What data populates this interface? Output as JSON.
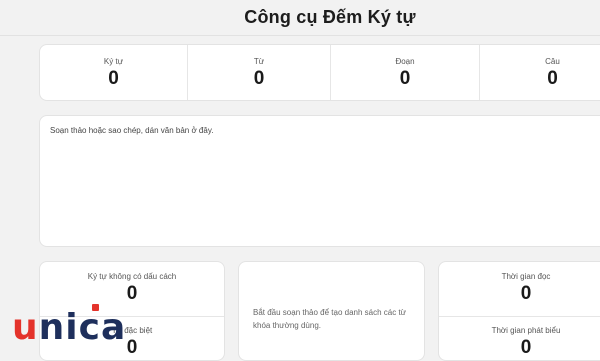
{
  "header": {
    "title": "Công cụ Đếm Ký tự"
  },
  "stats": [
    {
      "label": "Ký tự",
      "value": "0"
    },
    {
      "label": "Từ",
      "value": "0"
    },
    {
      "label": "Đoạn",
      "value": "0"
    },
    {
      "label": "Câu",
      "value": "0"
    }
  ],
  "editor": {
    "placeholder": "Soạn thảo hoặc sao chép, dán văn bản ở đây."
  },
  "left_card": {
    "top": {
      "label": "Ký tự không có dấu cách",
      "value": "0"
    },
    "bottom": {
      "label": "Từ đặc biệt",
      "value": "0"
    }
  },
  "mid_card": {
    "text": "Bắt đầu soạn thảo để tạo danh sách các từ khóa thường dùng."
  },
  "right_card": {
    "top": {
      "label": "Thời gian đọc",
      "value": "0"
    },
    "bottom": {
      "label": "Thời gian phát biểu",
      "value": "0"
    }
  },
  "logo": {
    "text_u": "u",
    "text_rest": "nica"
  },
  "colors": {
    "logo_red": "#e4332b",
    "logo_navy": "#1e2f5c",
    "background": "#f2f2f2"
  }
}
